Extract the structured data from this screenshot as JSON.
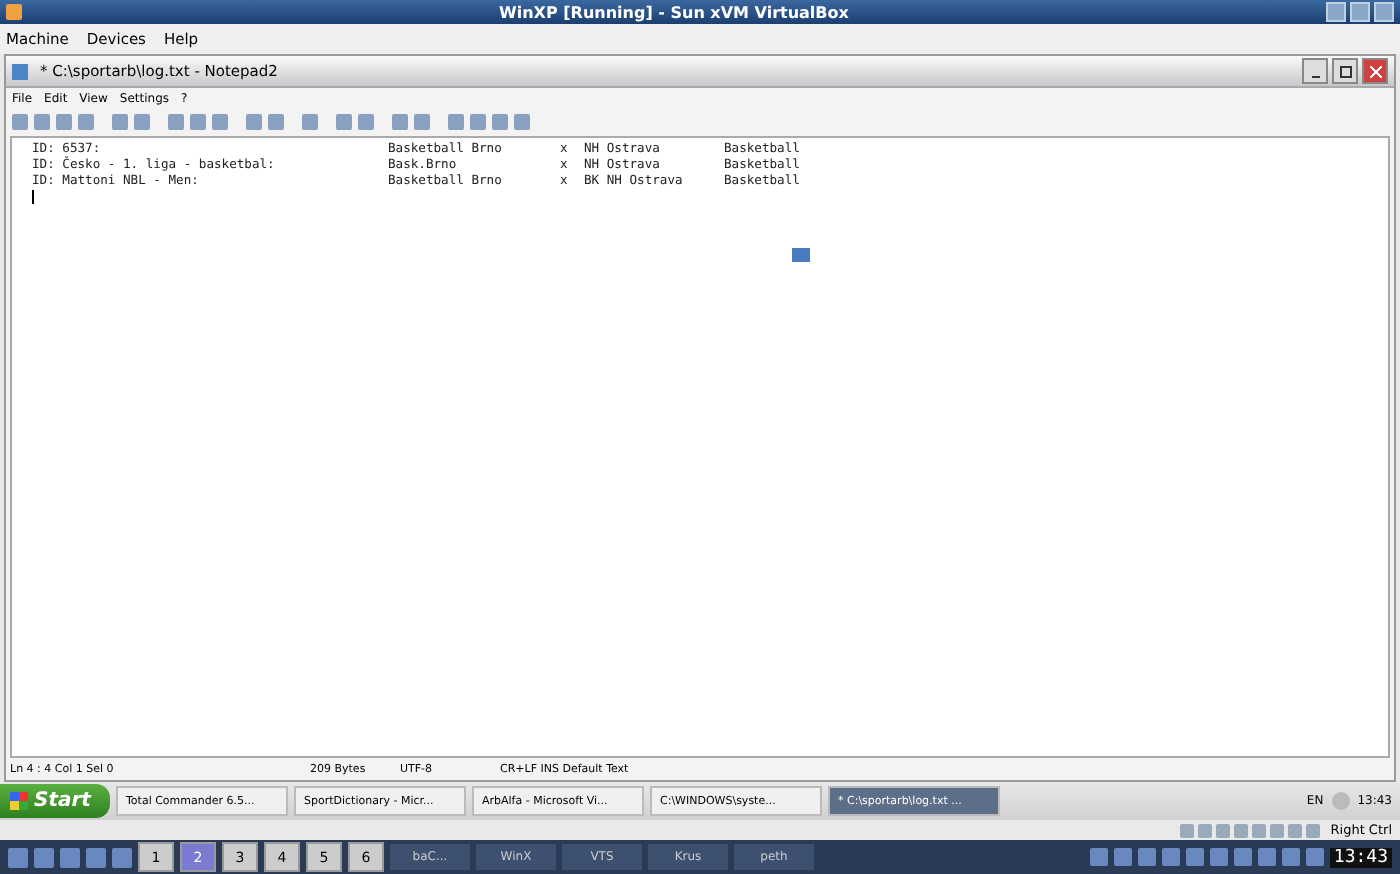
{
  "window": {
    "title": "WinXP [Running] - Sun xVM VirtualBox"
  },
  "vbox_menu": [
    "Machine",
    "Devices",
    "Help"
  ],
  "notepad": {
    "title": "* C:\\sportarb\\log.txt - Notepad2",
    "menu": [
      "File",
      "Edit",
      "View",
      "Settings",
      "?"
    ],
    "lines": [
      {
        "cells": [
          "ID: 6537:",
          "Basketball Brno",
          "x",
          "NH Ostrava",
          "Basketball"
        ]
      },
      {
        "cells": [
          "ID: Česko - 1. liga - basketbal:",
          "Bask.Brno",
          "x",
          "NH Ostrava",
          "Basketball"
        ]
      },
      {
        "cells": [
          "ID: Mattoni NBL - Men:",
          "Basketball Brno",
          "x",
          "BK NH Ostrava",
          "Basketball"
        ]
      }
    ],
    "status": [
      "Ln 4 : 4   Col 1   Sel 0",
      "209 Bytes",
      "UTF-8",
      "CR+LF   INS   Default Text"
    ]
  },
  "taskbar": {
    "start": "Start",
    "tasks": [
      {
        "label": "Total Commander 6.5...",
        "selected": false
      },
      {
        "label": "SportDictionary - Micr...",
        "selected": false
      },
      {
        "label": "ArbAlfa - Microsoft Vi...",
        "selected": false
      },
      {
        "label": "C:\\WINDOWS\\syste...",
        "selected": false
      },
      {
        "label": "* C:\\sportarb\\log.txt ...",
        "selected": true
      }
    ],
    "language": "EN",
    "clock": "13:43"
  },
  "vbox_status": {
    "host_key": "Right Ctrl"
  },
  "host_panel": {
    "desktops": [
      {
        "label": "1",
        "selected": false
      },
      {
        "label": "2",
        "selected": true
      },
      {
        "label": "3",
        "selected": false
      },
      {
        "label": "4",
        "selected": false
      },
      {
        "label": "5",
        "selected": false
      },
      {
        "label": "6",
        "selected": false
      }
    ],
    "tasks": [
      "baC...",
      "WinX",
      "VTS",
      "Krus",
      "peth"
    ],
    "clock": "13:43"
  }
}
